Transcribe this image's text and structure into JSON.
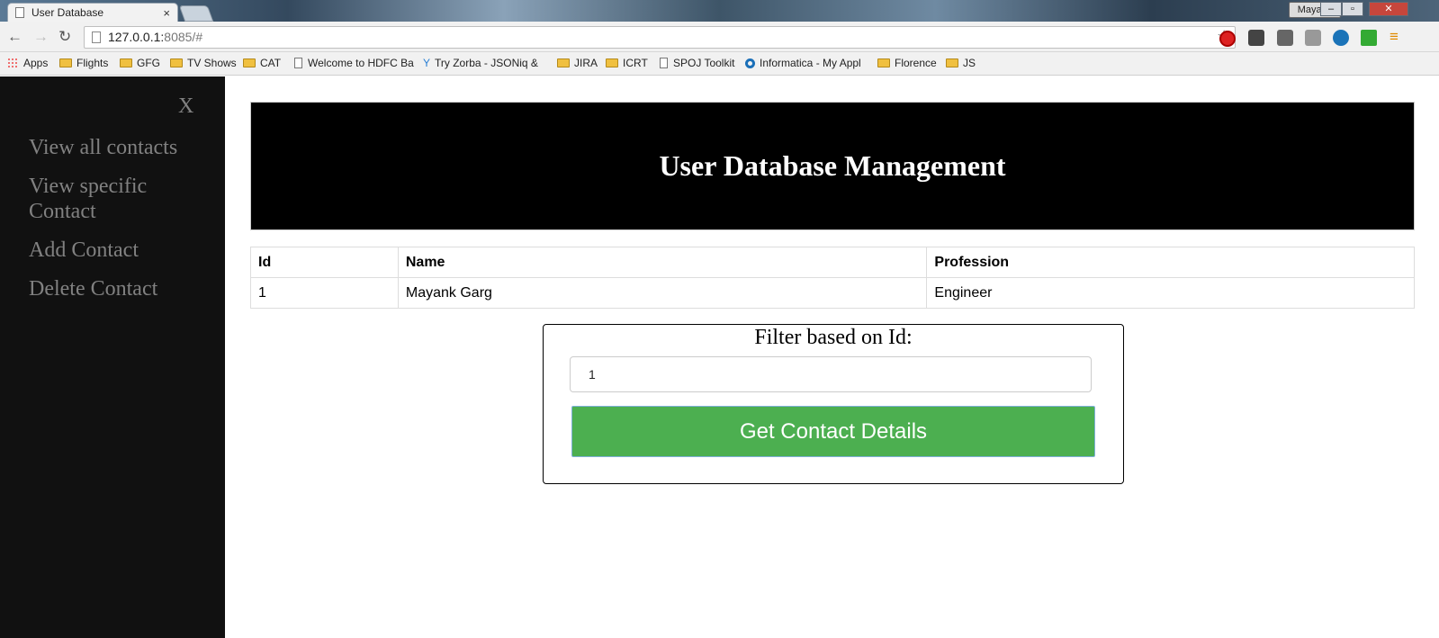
{
  "browser": {
    "tab_title": "User Database",
    "tab_close": "×",
    "profile_name": "Mayank",
    "url_host": "127.0.0.1:",
    "url_path": "8085/#",
    "bookmarks": [
      {
        "label": "Apps",
        "icon": "apps-grid-icon"
      },
      {
        "label": "Flights",
        "icon": "folder-icon"
      },
      {
        "label": "GFG",
        "icon": "folder-icon"
      },
      {
        "label": "TV Shows",
        "icon": "folder-icon"
      },
      {
        "label": "CAT",
        "icon": "folder-icon"
      },
      {
        "label": "Welcome to HDFC Ba",
        "icon": "page-icon"
      },
      {
        "label": "Try Zorba - JSONiq &",
        "icon": "zorba-icon"
      },
      {
        "label": "JIRA",
        "icon": "folder-icon"
      },
      {
        "label": "ICRT",
        "icon": "folder-icon"
      },
      {
        "label": "SPOJ Toolkit",
        "icon": "page-icon"
      },
      {
        "label": "Informatica - My Appl",
        "icon": "informatica-icon"
      },
      {
        "label": "Florence",
        "icon": "folder-icon"
      },
      {
        "label": "JS",
        "icon": "folder-icon"
      }
    ]
  },
  "sidebar": {
    "close_label": "X",
    "items": [
      {
        "label": "View all contacts"
      },
      {
        "label": "View specific Contact"
      },
      {
        "label": "Add Contact"
      },
      {
        "label": "Delete Contact"
      }
    ]
  },
  "header": {
    "title": "User Database Management"
  },
  "table": {
    "columns": [
      "Id",
      "Name",
      "Profession"
    ],
    "rows": [
      [
        "1",
        "Mayank Garg",
        "Engineer"
      ]
    ]
  },
  "filter": {
    "label": "Filter based on Id:",
    "input_value": "1",
    "button_label": "Get Contact Details"
  },
  "colors": {
    "sidebar_bg": "#111111",
    "header_bg": "#000000",
    "button_bg": "#4caf50"
  }
}
